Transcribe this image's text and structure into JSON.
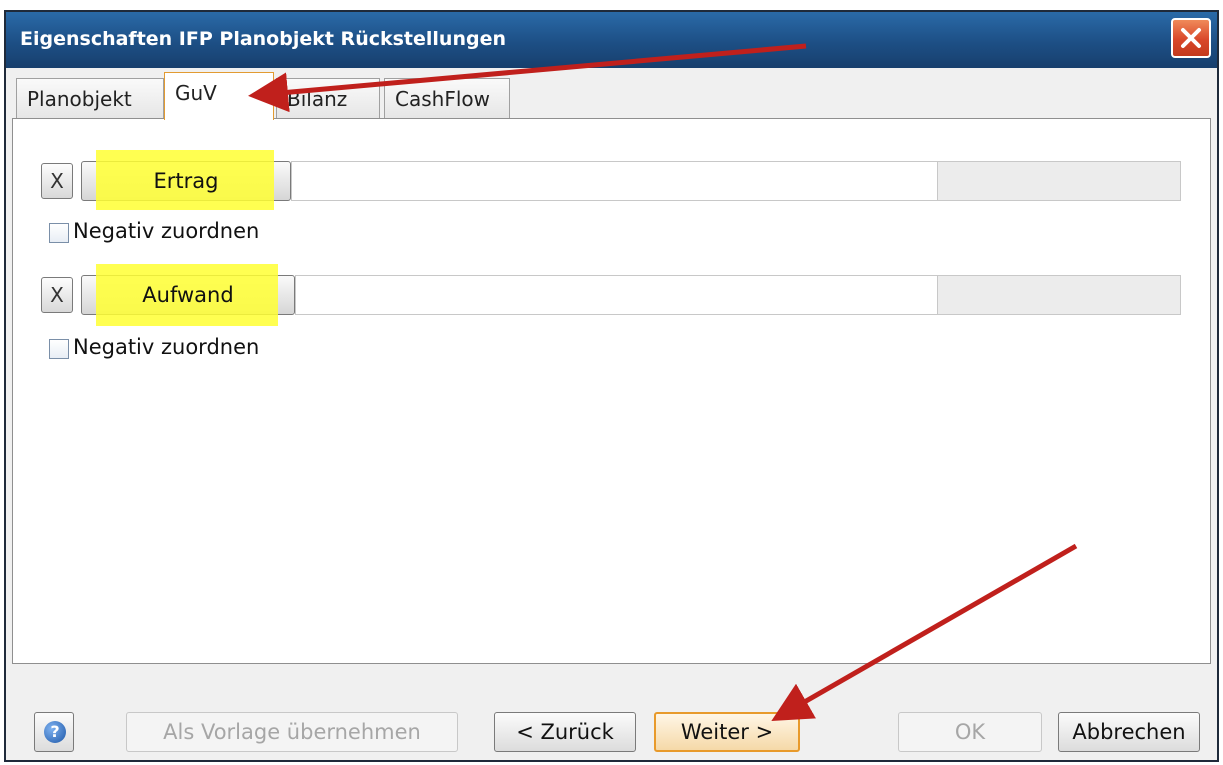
{
  "window": {
    "title": "Eigenschaften IFP Planobjekt Rückstellungen",
    "close_icon": "close-icon"
  },
  "tabs": [
    {
      "label": "Planobjekt",
      "active": false
    },
    {
      "label": "GuV",
      "active": true
    },
    {
      "label": "Bilanz",
      "active": false
    },
    {
      "label": "CashFlow",
      "active": false
    }
  ],
  "rows": [
    {
      "clear_label": "X",
      "button_label": "Ertrag",
      "field_value": "",
      "amount_value": "",
      "checkbox_label": "Negativ zuordnen",
      "checked": false
    },
    {
      "clear_label": "X",
      "button_label": "Aufwand",
      "field_value": "",
      "amount_value": "",
      "checkbox_label": "Negativ zuordnen",
      "checked": false
    }
  ],
  "footer": {
    "help_icon": "help-icon",
    "template_label": "Als Vorlage übernehmen",
    "back_label": "< Zurück",
    "next_label": "Weiter >",
    "ok_label": "OK",
    "cancel_label": "Abbrechen"
  },
  "colors": {
    "highlight": "#ffff33",
    "annotation_arrow": "#c0201c",
    "titlebar": "#1d4f85"
  }
}
